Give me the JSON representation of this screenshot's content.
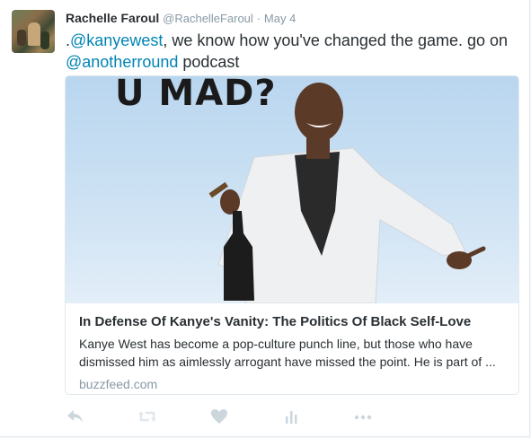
{
  "tweet": {
    "name": "Rachelle Faroul",
    "handle": "@RachelleFaroul",
    "separator": "·",
    "date": "May 4",
    "text_prefix": ".",
    "mention1": "@kanyewest",
    "text_middle": ", we know how you've changed the game. go on",
    "mention2": "@anotherround",
    "text_suffix": " podcast"
  },
  "card": {
    "image_caption": "U MAD?",
    "title": "In Defense Of Kanye's Vanity: The Politics Of Black Self-Love",
    "description": "Kanye West has become a pop-culture punch line, but those who have dismissed him as aimlessly arrogant have missed the point. He is part of ...",
    "domain": "buzzfeed.com"
  },
  "actions": [
    {
      "icon": "reply-icon"
    },
    {
      "icon": "retweet-icon"
    },
    {
      "icon": "like-icon"
    },
    {
      "icon": "analytics-icon"
    },
    {
      "icon": "more-icon"
    }
  ],
  "colors": {
    "link": "#0084b4",
    "muted": "#8899a6",
    "icon": "#ccd6dd"
  }
}
